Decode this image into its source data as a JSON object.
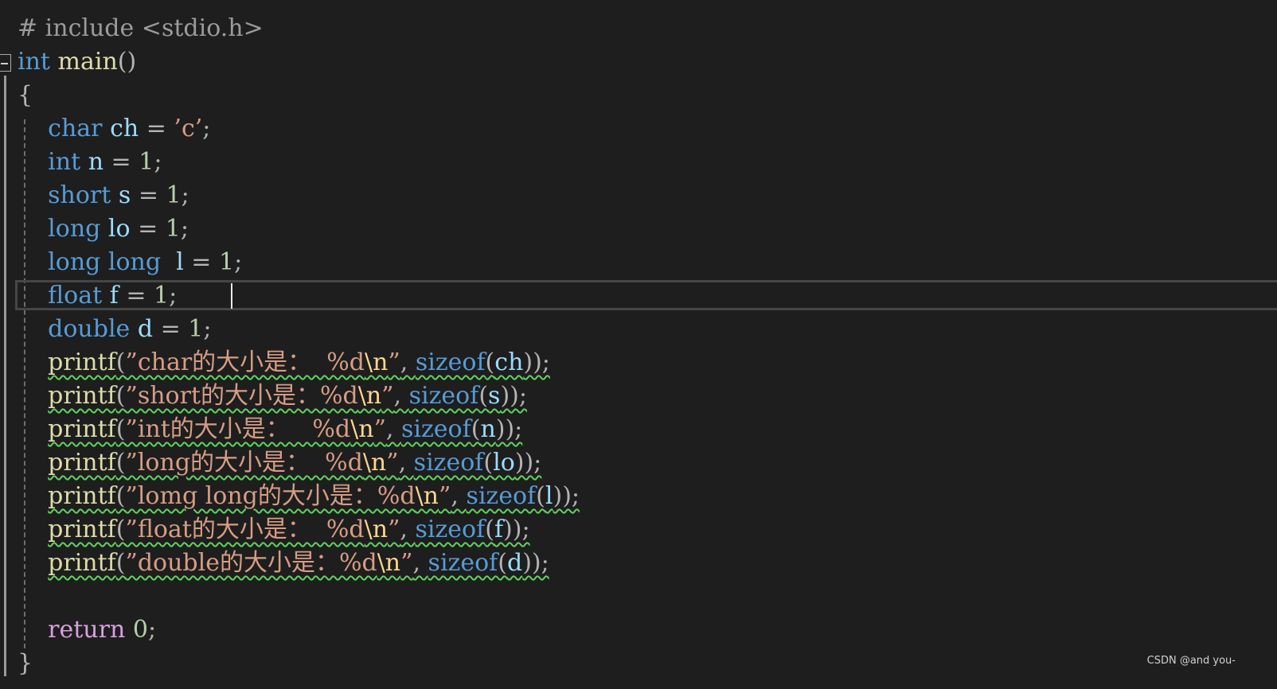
{
  "editor": {
    "lines": [
      [
        [
          "# include <stdio.h>",
          "pre"
        ]
      ],
      [
        [
          "int",
          "kw"
        ],
        [
          " ",
          ""
        ],
        [
          "main",
          "fn"
        ],
        [
          "()",
          "op"
        ]
      ],
      [
        [
          "{",
          "op"
        ]
      ],
      [
        [
          "    ",
          ""
        ],
        [
          "char",
          "kw"
        ],
        [
          " ",
          ""
        ],
        [
          "ch",
          "id"
        ],
        [
          " = ",
          "op"
        ],
        [
          "’c’",
          "str"
        ],
        [
          ";",
          "op"
        ]
      ],
      [
        [
          "    ",
          ""
        ],
        [
          "int",
          "kw"
        ],
        [
          " ",
          ""
        ],
        [
          "n",
          "id"
        ],
        [
          " = ",
          "op"
        ],
        [
          "1",
          "num"
        ],
        [
          ";",
          "op"
        ]
      ],
      [
        [
          "    ",
          ""
        ],
        [
          "short",
          "kw"
        ],
        [
          " ",
          ""
        ],
        [
          "s",
          "id"
        ],
        [
          " = ",
          "op"
        ],
        [
          "1",
          "num"
        ],
        [
          ";",
          "op"
        ]
      ],
      [
        [
          "    ",
          ""
        ],
        [
          "long",
          "kw"
        ],
        [
          " ",
          ""
        ],
        [
          "lo",
          "id"
        ],
        [
          " = ",
          "op"
        ],
        [
          "1",
          "num"
        ],
        [
          ";",
          "op"
        ]
      ],
      [
        [
          "    ",
          ""
        ],
        [
          "long long",
          "kw"
        ],
        [
          "  ",
          ""
        ],
        [
          "l",
          "id"
        ],
        [
          " = ",
          "op"
        ],
        [
          "1",
          "num"
        ],
        [
          ";",
          "op"
        ]
      ],
      [
        [
          "    ",
          ""
        ],
        [
          "float",
          "kw"
        ],
        [
          " ",
          ""
        ],
        [
          "f",
          "id"
        ],
        [
          " = ",
          "op"
        ],
        [
          "1",
          "num"
        ],
        [
          ";",
          "op"
        ]
      ],
      [
        [
          "    ",
          ""
        ],
        [
          "double",
          "kw"
        ],
        [
          " ",
          ""
        ],
        [
          "d",
          "id"
        ],
        [
          " = ",
          "op"
        ],
        [
          "1",
          "num"
        ],
        [
          ";",
          "op"
        ]
      ],
      [
        [
          "    ",
          ""
        ],
        [
          "printf",
          "fn",
          "sq"
        ],
        [
          "(",
          "op",
          "sq"
        ],
        [
          "”char的大小是：  %d",
          "str",
          "sq"
        ],
        [
          "\\n",
          "esc",
          "sq"
        ],
        [
          "”",
          "str",
          "sq"
        ],
        [
          ", ",
          "op",
          "sq"
        ],
        [
          "sizeof",
          "kw",
          "sq"
        ],
        [
          "(",
          "op",
          "sq"
        ],
        [
          "ch",
          "id",
          "sq"
        ],
        [
          "));",
          "op",
          "sq"
        ]
      ],
      [
        [
          "    ",
          ""
        ],
        [
          "printf",
          "fn",
          "sq"
        ],
        [
          "(",
          "op",
          "sq"
        ],
        [
          "”short的大小是：%d",
          "str",
          "sq"
        ],
        [
          "\\n",
          "esc",
          "sq"
        ],
        [
          "”",
          "str",
          "sq"
        ],
        [
          ", ",
          "op",
          "sq"
        ],
        [
          "sizeof",
          "kw",
          "sq"
        ],
        [
          "(",
          "op",
          "sq"
        ],
        [
          "s",
          "id",
          "sq"
        ],
        [
          "));",
          "op",
          "sq"
        ]
      ],
      [
        [
          "    ",
          ""
        ],
        [
          "printf",
          "fn",
          "sq"
        ],
        [
          "(",
          "op",
          "sq"
        ],
        [
          "”int的大小是：   %d",
          "str",
          "sq"
        ],
        [
          "\\n",
          "esc",
          "sq"
        ],
        [
          "”",
          "str",
          "sq"
        ],
        [
          ", ",
          "op",
          "sq"
        ],
        [
          "sizeof",
          "kw",
          "sq"
        ],
        [
          "(",
          "op",
          "sq"
        ],
        [
          "n",
          "id",
          "sq"
        ],
        [
          "));",
          "op",
          "sq"
        ]
      ],
      [
        [
          "    ",
          ""
        ],
        [
          "printf",
          "fn",
          "sq"
        ],
        [
          "(",
          "op",
          "sq"
        ],
        [
          "”long的大小是：  %d",
          "str",
          "sq"
        ],
        [
          "\\n",
          "esc",
          "sq"
        ],
        [
          "”",
          "str",
          "sq"
        ],
        [
          ", ",
          "op",
          "sq"
        ],
        [
          "sizeof",
          "kw",
          "sq"
        ],
        [
          "(",
          "op",
          "sq"
        ],
        [
          "lo",
          "id",
          "sq"
        ],
        [
          "));",
          "op",
          "sq"
        ]
      ],
      [
        [
          "    ",
          ""
        ],
        [
          "printf",
          "fn",
          "sq"
        ],
        [
          "(",
          "op",
          "sq"
        ],
        [
          "”lomg long的大小是：%d",
          "str",
          "sq"
        ],
        [
          "\\n",
          "esc",
          "sq"
        ],
        [
          "”",
          "str",
          "sq"
        ],
        [
          ", ",
          "op",
          "sq"
        ],
        [
          "sizeof",
          "kw",
          "sq"
        ],
        [
          "(",
          "op",
          "sq"
        ],
        [
          "l",
          "id",
          "sq"
        ],
        [
          "));",
          "op",
          "sq"
        ]
      ],
      [
        [
          "    ",
          ""
        ],
        [
          "printf",
          "fn",
          "sq"
        ],
        [
          "(",
          "op",
          "sq"
        ],
        [
          "”float的大小是：  %d",
          "str",
          "sq"
        ],
        [
          "\\n",
          "esc",
          "sq"
        ],
        [
          "”",
          "str",
          "sq"
        ],
        [
          ", ",
          "op",
          "sq"
        ],
        [
          "sizeof",
          "kw",
          "sq"
        ],
        [
          "(",
          "op",
          "sq"
        ],
        [
          "f",
          "id",
          "sq"
        ],
        [
          "));",
          "op",
          "sq"
        ]
      ],
      [
        [
          "    ",
          ""
        ],
        [
          "printf",
          "fn",
          "sq"
        ],
        [
          "(",
          "op",
          "sq"
        ],
        [
          "”double的大小是：%d",
          "str",
          "sq"
        ],
        [
          "\\n",
          "esc",
          "sq"
        ],
        [
          "”",
          "str",
          "sq"
        ],
        [
          ", ",
          "op",
          "sq"
        ],
        [
          "sizeof",
          "kw",
          "sq"
        ],
        [
          "(",
          "op",
          "sq"
        ],
        [
          "d",
          "id",
          "sq"
        ],
        [
          "));",
          "op",
          "sq"
        ]
      ],
      [],
      [
        [
          "    ",
          ""
        ],
        [
          "return",
          "ctl"
        ],
        [
          " ",
          ""
        ],
        [
          "0",
          "num"
        ],
        [
          ";",
          "op"
        ]
      ],
      [
        [
          "}",
          "op"
        ]
      ]
    ]
  },
  "watermark": "CSDN @and you-",
  "colors": {
    "background": "#1e1e1e",
    "keyword": "#569cd6",
    "control_keyword": "#d8a0df",
    "identifier": "#9cdcfe",
    "function": "#dcdcaa",
    "string": "#d69d85",
    "number": "#b5cea8",
    "preprocessor": "#9b9b9b",
    "squiggle": "#5fd25f"
  }
}
